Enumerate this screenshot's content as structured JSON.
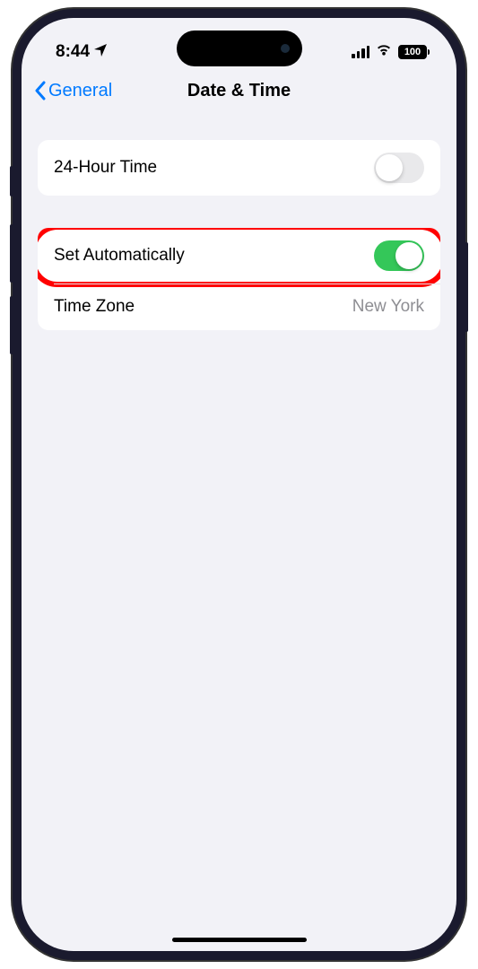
{
  "statusBar": {
    "time": "8:44",
    "batteryLevel": "100"
  },
  "nav": {
    "backLabel": "General",
    "title": "Date & Time"
  },
  "settings": {
    "group1": {
      "row1": {
        "label": "24-Hour Time",
        "toggleOn": false
      }
    },
    "group2": {
      "row1": {
        "label": "Set Automatically",
        "toggleOn": true,
        "highlighted": true
      },
      "row2": {
        "label": "Time Zone",
        "value": "New York"
      }
    }
  }
}
